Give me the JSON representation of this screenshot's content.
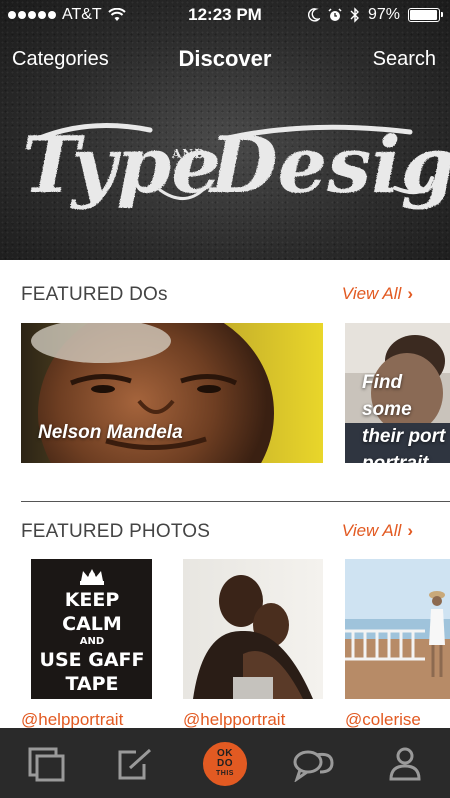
{
  "status_bar": {
    "carrier": "AT&T",
    "time": "12:23 PM",
    "battery": "97%",
    "battery_level": 0.97
  },
  "nav": {
    "left": "Categories",
    "title": "Discover",
    "right": "Search"
  },
  "hero": {
    "word1": "Type",
    "connector": "AND",
    "word2": "Design"
  },
  "featured_dos": {
    "title": "FEATURED DOs",
    "view_all": "View All",
    "cards": [
      {
        "caption": "Nelson Mandela"
      },
      {
        "caption_lines": [
          "Find some",
          "their port",
          "portrait. D"
        ]
      }
    ]
  },
  "featured_photos": {
    "title": "FEATURED PHOTOS",
    "view_all": "View All",
    "photos": [
      {
        "handle": "@helpportrait",
        "lines": [
          "KEEP",
          "CALM",
          "AND",
          "USE GAFF",
          "TAPE"
        ]
      },
      {
        "handle": "@helpportrait"
      },
      {
        "handle": "@colerise"
      }
    ]
  },
  "tabbar": {
    "center_lines": [
      "OK",
      "DO",
      "THIS"
    ],
    "tabs": [
      "stack-icon",
      "edit-icon",
      "ok-do-this-icon",
      "chat-icon",
      "profile-icon"
    ]
  },
  "colors": {
    "accent": "#e25a22",
    "tabbar": "#2a2a2a",
    "hero": "#2c2c2c"
  }
}
